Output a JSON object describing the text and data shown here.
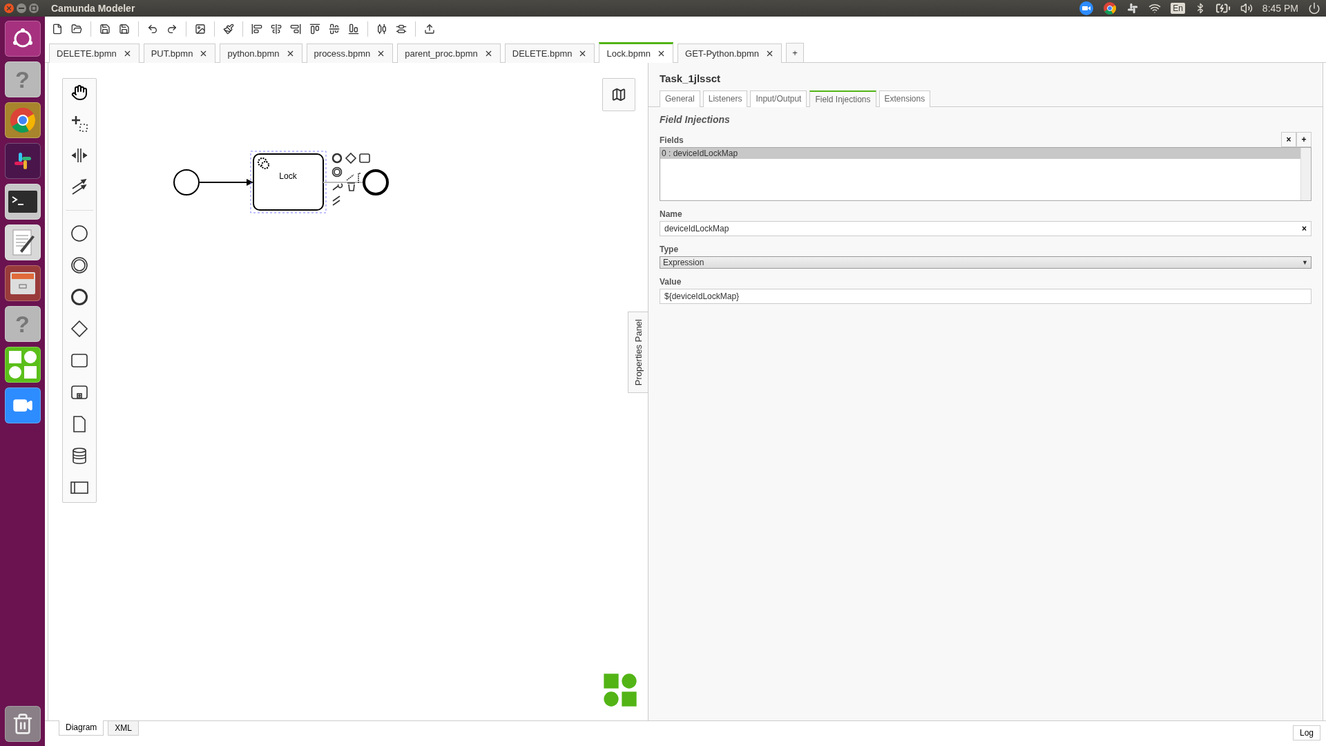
{
  "window": {
    "title": "Camunda Modeler"
  },
  "tray": {
    "keyboard": "En",
    "clock": "8:45 PM"
  },
  "launcher": [
    {
      "kind": "ubuntu"
    },
    {
      "kind": "unknown",
      "glyph": "?"
    },
    {
      "kind": "chrome"
    },
    {
      "kind": "slack"
    },
    {
      "kind": "terminal"
    },
    {
      "kind": "editor"
    },
    {
      "kind": "files"
    },
    {
      "kind": "unknown",
      "glyph": "?"
    },
    {
      "kind": "camunda"
    },
    {
      "kind": "zoom"
    }
  ],
  "file_tabs": [
    {
      "label": "DELETE.bpmn",
      "selected": false
    },
    {
      "label": "PUT.bpmn",
      "selected": false
    },
    {
      "label": "python.bpmn",
      "selected": false
    },
    {
      "label": "process.bpmn",
      "selected": false
    },
    {
      "label": "parent_proc.bpmn",
      "selected": false
    },
    {
      "label": "DELETE.bpmn",
      "selected": false
    },
    {
      "label": "Lock.bpmn",
      "selected": true
    },
    {
      "label": "GET-Python.bpmn",
      "selected": false
    }
  ],
  "add_tab": "+",
  "diagram": {
    "task_label": "Lock"
  },
  "properties_toggle": "Properties Panel",
  "properties": {
    "element_id": "Task_1jlssct",
    "tabs": [
      {
        "label": "General",
        "selected": false
      },
      {
        "label": "Listeners",
        "selected": false
      },
      {
        "label": "Input/Output",
        "selected": false
      },
      {
        "label": "Field Injections",
        "selected": true
      },
      {
        "label": "Extensions",
        "selected": false
      }
    ],
    "section_title": "Field Injections",
    "fields": {
      "label": "Fields",
      "remove": "×",
      "add": "+",
      "items": [
        {
          "label": "0 : deviceIdLockMap",
          "selected": true
        }
      ]
    },
    "name": {
      "label": "Name",
      "value": "deviceIdLockMap",
      "clear": "×"
    },
    "type": {
      "label": "Type",
      "value": "Expression",
      "caret": "▼"
    },
    "value": {
      "label": "Value",
      "value": "${deviceIdLockMap}"
    }
  },
  "view_tabs": [
    {
      "label": "Diagram",
      "selected": true
    },
    {
      "label": "XML",
      "selected": false
    }
  ],
  "log": "Log"
}
